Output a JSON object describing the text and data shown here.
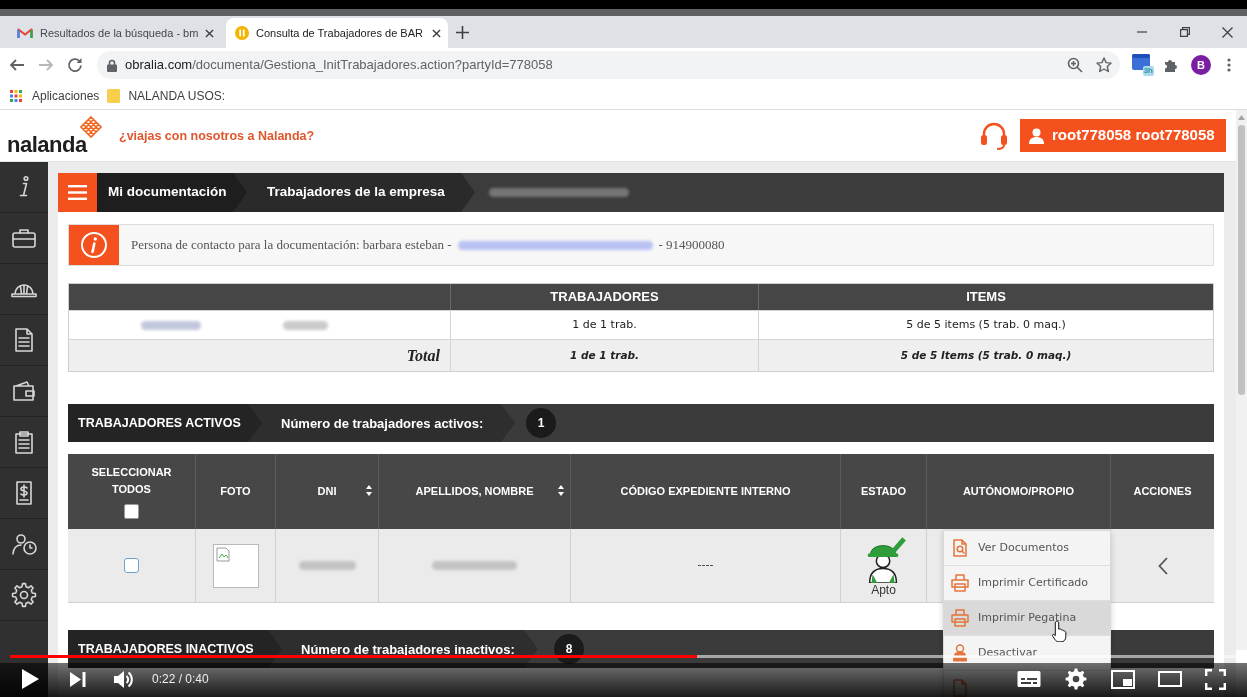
{
  "browser": {
    "tabs": [
      {
        "title": "Resultados de la búsqueda - bm",
        "kind": "gmail",
        "selected": false
      },
      {
        "title": "Consulta de Trabajadores de BAR",
        "kind": "site",
        "selected": true
      }
    ],
    "address": {
      "host": "obralia.com",
      "path": "/documenta/Gestiona_InitTrabajadores.action?partyId=778058"
    },
    "extension_badge": "3h",
    "profile_initial": "B",
    "bookmarks": [
      {
        "label": "Aplicaciones",
        "kind": "apps"
      },
      {
        "label": "NALANDA USOS:",
        "kind": "folder"
      }
    ]
  },
  "header": {
    "logo": "nalanda",
    "tagline": "¿viajas con nosotros a Nalanda?",
    "user": "root778058 root778058"
  },
  "breadcrumb": [
    {
      "label": "Mi documentación"
    },
    {
      "label": "Trabajadores de la empresa"
    }
  ],
  "contact_notice": {
    "text": "Persona de contacto para la documentación: barbara esteban -",
    "phone": "- 914900080"
  },
  "summary_table": {
    "columns": [
      "TRABAJADORES",
      "ITEMS"
    ],
    "rows": [
      {
        "kind": "data",
        "cells": [
          "1 de 1 trab.",
          "5 de 5 items (5 trab. 0 maq.)"
        ]
      },
      {
        "kind": "total",
        "label": "Total",
        "cells": [
          "1 de 1 trab.",
          "5 de 5 Items (5 trab. 0 maq.)"
        ]
      }
    ]
  },
  "active_workers": {
    "title": "TRABAJADORES ACTIVOS",
    "count_label": "Número de trabajadores activos:",
    "count": "1",
    "columns": [
      {
        "label": "SELECCIONAR TODOS",
        "kind": "select_all",
        "checked": false
      },
      {
        "label": "FOTO",
        "kind": "plain"
      },
      {
        "label": "DNI",
        "kind": "sortable"
      },
      {
        "label": "APELLIDOS, NOMBRE",
        "kind": "sortable"
      },
      {
        "label": "CÓDIGO EXPEDIENTE INTERNO",
        "kind": "plain"
      },
      {
        "label": "ESTADO",
        "kind": "plain"
      },
      {
        "label": "AUTÓNOMO/PROPIO",
        "kind": "plain"
      },
      {
        "label": "ACCIONES",
        "kind": "plain"
      }
    ],
    "rows": [
      {
        "checked": false,
        "code": "----",
        "status": "Apto"
      }
    ]
  },
  "action_menu": {
    "items": [
      {
        "label": "Ver Documentos",
        "kind": "document_search",
        "hovered": false
      },
      {
        "label": "Imprimir Certificado",
        "kind": "printer",
        "hovered": false
      },
      {
        "label": "Imprimir Pegatina",
        "kind": "printer",
        "hovered": true
      },
      {
        "label": "Desactivar",
        "kind": "deactivate",
        "hovered": false
      },
      {
        "kind": "document"
      }
    ]
  },
  "inactive_workers": {
    "title": "TRABAJADORES INACTIVOS",
    "count_label": "Número de trabajadores inactivos:",
    "count": "8"
  },
  "video_player": {
    "progress": {
      "level": 0.56
    },
    "time": "0:22 / 0:40"
  }
}
